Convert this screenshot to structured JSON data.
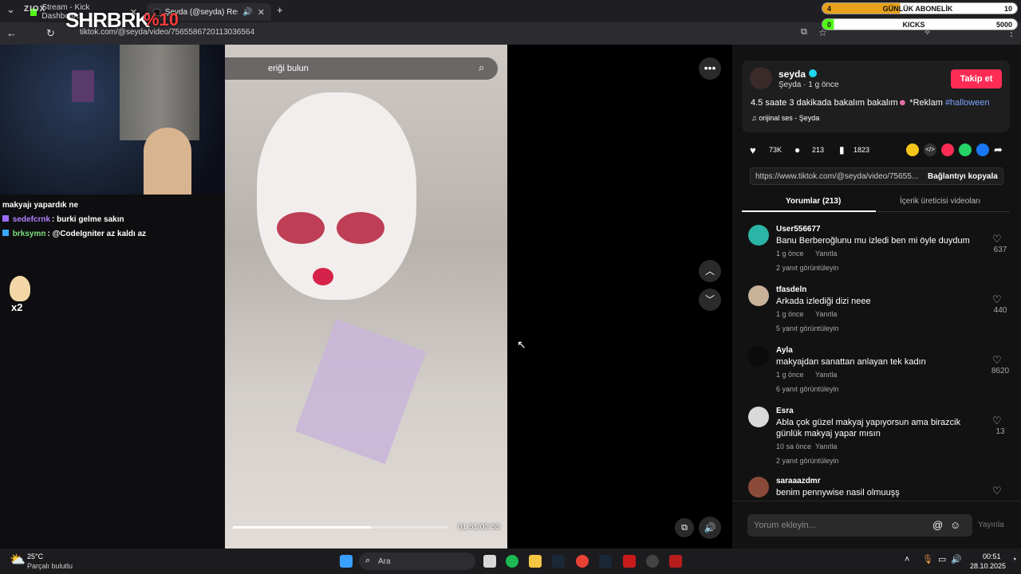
{
  "browser": {
    "tabs": [
      {
        "label": "Stream - Kick Dashboard"
      },
      {
        "label": "Şeyda (@seyda) Resmi | Tik"
      }
    ],
    "url": "tiktok.com/@seyda/video/7565586720113036564"
  },
  "overlay": {
    "brand": "SHRBRK",
    "promo": "%10",
    "subs": {
      "left": "4",
      "label": "GÜNLÜK ABONELİK",
      "right": "10",
      "progress": 0.4
    },
    "kicks": {
      "left": "0",
      "label": "KICKS",
      "right": "5000",
      "progress": 0.0
    }
  },
  "chat": {
    "lines": [
      {
        "user": "",
        "text": "makyajı yapardık ne"
      },
      {
        "user": "sedefcrnk",
        "text": ": burki gelme sakın",
        "color": "#b080ff"
      },
      {
        "user": "brksymn",
        "text": ": @CodeIgniter az kaldı az",
        "color": "#7fe07f"
      }
    ],
    "badge_count": "x2"
  },
  "video": {
    "search_text": "eriği bulun",
    "time": "01:51/02:53",
    "progress": 0.64
  },
  "creator": {
    "name": "seyda",
    "sub": "Şeyda · 1 g önce",
    "follow_label": "Takip et",
    "caption": "4.5 saate 3 dakikada bakalım bakalım",
    "caption_tail": " *Reklam ",
    "hashtag": "#halloween",
    "sound": "orijinal ses - Şeyda",
    "likes": "73K",
    "comments": "213",
    "saves": "1823",
    "link_url": "https://www.tiktok.com/@seyda/video/75655...",
    "copy_label": "Bağlantıyı kopyala",
    "tab_comments": "Yorumlar (213)",
    "tab_videos": "İçerik üreticisi videoları"
  },
  "comments": [
    {
      "user": "User556677",
      "text": "Banu Berberoğlunu mu izledi ben mi öyle duydum",
      "time": "1 g önce",
      "reply": "Yanıtla",
      "replies": "2 yanıt görüntüleyin",
      "likes": "637",
      "avatar": "#2bb5a6"
    },
    {
      "user": "tfasdeln",
      "text": "Arkada izlediği dizi neee",
      "time": "1 g önce",
      "reply": "Yanıtla",
      "replies": "5 yanıt görüntüleyin",
      "likes": "440",
      "avatar": "#c9b29a"
    },
    {
      "user": "Ayla",
      "text": "makyajdan sanattan anlayan tek kadın",
      "time": "1 g önce",
      "reply": "Yanıtla",
      "replies": "6 yanıt görüntüleyin",
      "likes": "8620",
      "avatar": "#0b0b0b"
    },
    {
      "user": "Esra",
      "text": "Abla çok güzel makyaj yapıyorsun ama birazcik",
      "text2": "günlük makyaj yapar mısın",
      "time": "10 sa önce",
      "reply": "Yanıtla",
      "replies": "2 yanıt görüntüleyin",
      "likes": "13",
      "avatar": "#d9d9d9"
    },
    {
      "user": "saraaazdmr",
      "text": "benim pennywise nasil olmuuşş",
      "avatar": "#8a4a3a"
    }
  ],
  "comment_input": {
    "placeholder": "Yorum ekleyin...",
    "post": "Yayınla"
  },
  "taskbar": {
    "weather_temp": "25°C",
    "weather_desc": "Parçalı bulutlu",
    "search": "Ara",
    "time": "00:51",
    "date": "28.10.2025"
  }
}
